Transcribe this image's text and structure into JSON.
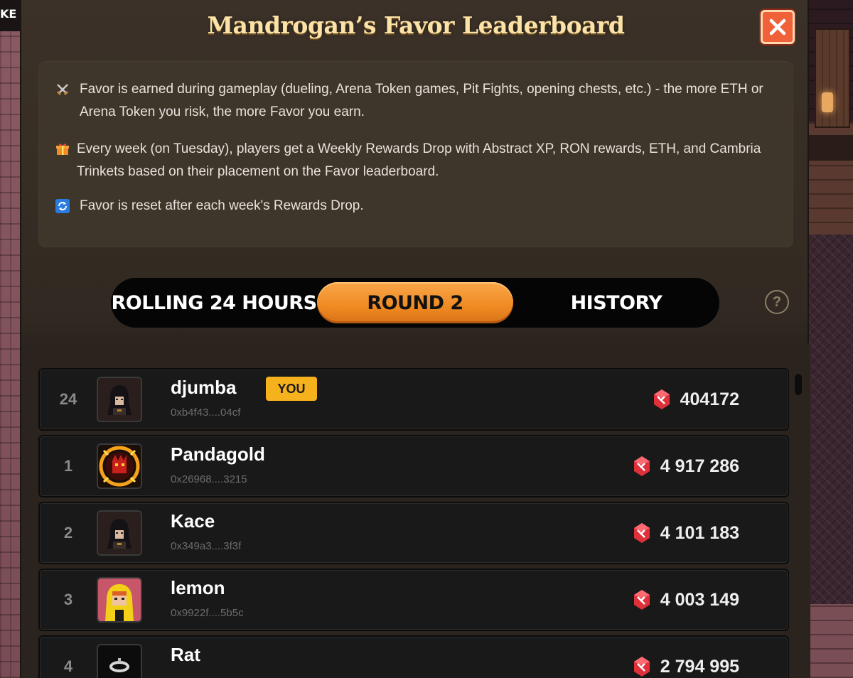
{
  "background": {
    "left_label": "KE"
  },
  "modal": {
    "title": "Mandrogan’s Favor Leaderboard",
    "close_label": "✕"
  },
  "info": {
    "items": [
      {
        "icon": "crossed-swords-icon",
        "text": "Favor is earned during gameplay (dueling, Arena Token games, Pit Fights, opening chests, etc.) - the more ETH or Arena Token you risk, the more Favor you earn."
      },
      {
        "icon": "gift-icon",
        "text": "Every week (on Tuesday), players get a Weekly Rewards Drop with Abstract XP, RON rewards, ETH, and Cambria Trinkets based on their placement on the Favor leaderboard."
      },
      {
        "icon": "refresh-icon",
        "text": "Favor is reset after each week's Rewards Drop."
      }
    ]
  },
  "tabs": {
    "items": [
      {
        "label": "ROLLING 24 HOURS",
        "active": false
      },
      {
        "label": "ROUND 2",
        "active": true
      },
      {
        "label": "HISTORY",
        "active": false
      }
    ],
    "help_label": "?"
  },
  "leaderboard": {
    "you_label": "YOU",
    "rows": [
      {
        "rank": "24",
        "name": "djumba",
        "address": "0xb4f43....04cf",
        "score": "404172",
        "is_you": true,
        "avatar": "dark-hooded"
      },
      {
        "rank": "1",
        "name": "Pandagold",
        "address": "0x26968....3215",
        "score": "4 917 286",
        "is_you": false,
        "avatar": "fire-creature"
      },
      {
        "rank": "2",
        "name": "Kace",
        "address": "0x349a3....3f3f",
        "score": "4 101 183",
        "is_you": false,
        "avatar": "dark-hooded"
      },
      {
        "rank": "3",
        "name": "lemon",
        "address": "0x9922f....5b5c",
        "score": "4 003 149",
        "is_you": false,
        "avatar": "yellow-raincoat"
      },
      {
        "rank": "4",
        "name": "Rat",
        "address": "",
        "score": "2 794 995",
        "is_you": false,
        "avatar": "ring"
      }
    ]
  },
  "colors": {
    "accent_orange": "#ef8a22",
    "close_red": "#f0613a",
    "you_badge": "#f6b21c",
    "gem_red": "#e0303a",
    "title_cream": "#fbe3a8"
  }
}
